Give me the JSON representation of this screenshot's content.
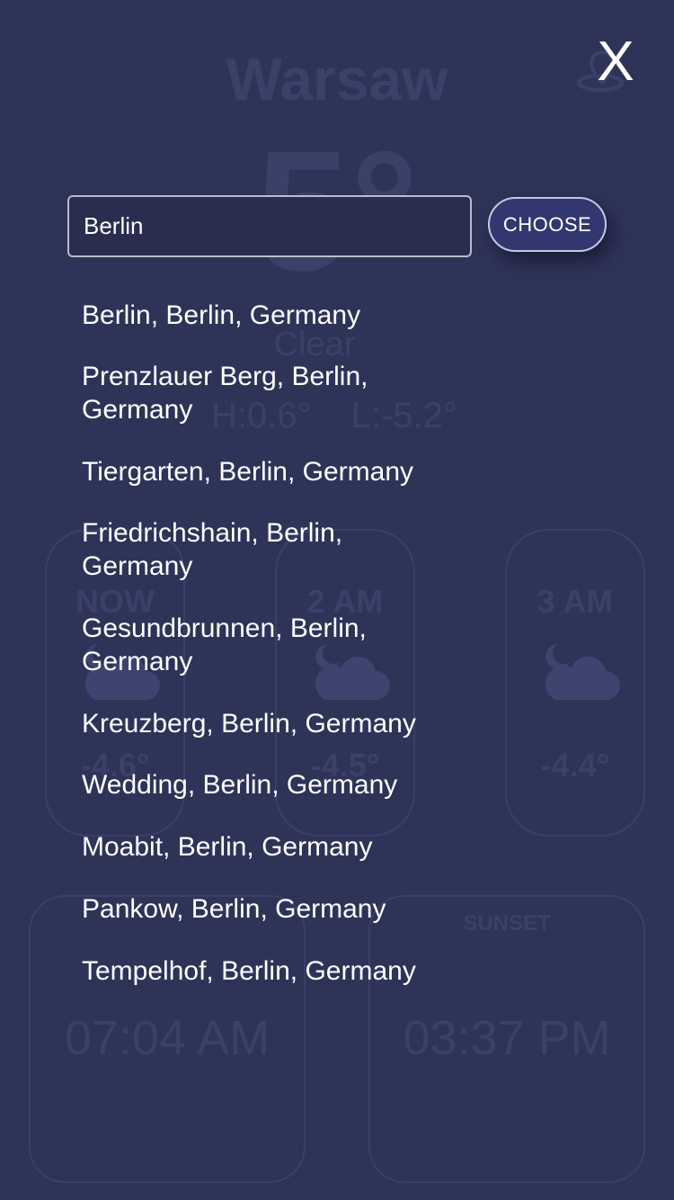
{
  "background": {
    "city": "Warsaw",
    "temperature": "5°",
    "condition": "Clear",
    "high": "H:0.6°",
    "low": "L:-5.2°",
    "hourly": [
      {
        "time": "NOW",
        "temp": "-4.6°",
        "icon": "moon-cloud-icon"
      },
      {
        "time": "2 AM",
        "temp": "-4.5°",
        "icon": "moon-cloud-icon"
      },
      {
        "time": "3 AM",
        "temp": "-4.4°",
        "icon": "moon-cloud-icon"
      }
    ],
    "sunrise": {
      "label": "",
      "time": "07:04 AM"
    },
    "sunset": {
      "label": "SUNSET",
      "time": "03:37 PM"
    }
  },
  "overlay": {
    "close_label": "X",
    "search_value": "Berlin",
    "choose_label": "CHOOSE",
    "results": [
      "Berlin, Berlin, Germany",
      "Prenzlauer Berg, Berlin, Germany",
      "Tiergarten, Berlin, Germany",
      "Friedrichshain, Berlin, Germany",
      "Gesundbrunnen, Berlin, Germany",
      "Kreuzberg, Berlin, Germany",
      "Wedding, Berlin, Germany",
      "Moabit, Berlin, Germany",
      "Pankow, Berlin, Germany",
      "Tempelhof, Berlin, Germany"
    ]
  },
  "colors": {
    "background": "#2e3358",
    "faded_text": "#3a4068",
    "input_background": "#2a2d4f",
    "button_background": "#33376f",
    "text": "#ffffff"
  }
}
